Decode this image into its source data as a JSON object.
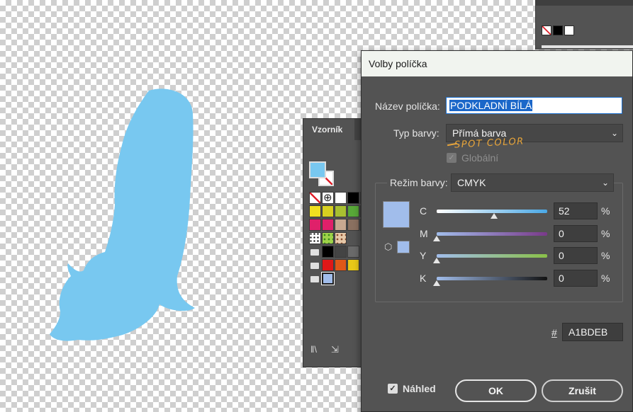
{
  "app_colors": {
    "accent": "#1b67c9",
    "swatch_color": "#A1BDEB",
    "artwork_fill": "#78C8F0",
    "annotation": "#E8A53A"
  },
  "swatches_panel": {
    "tab_label": "Vzorník",
    "icons": [
      "library-icon",
      "import-swatches-icon"
    ],
    "rows": [
      [
        "none",
        "registration",
        "#ffffff",
        "#000000",
        "#2a8a3a"
      ],
      [
        "#f0e020",
        "#d8d020",
        "#a8c030",
        "#58a838",
        "#2a9a48"
      ],
      [
        "#e0206a",
        "#e0206a",
        "#c8a890",
        "#8a7060",
        "#5a4a40"
      ],
      [
        "pattern1",
        "pattern2",
        "pattern3"
      ],
      [
        "folder",
        "#000000",
        "#444444",
        "#6a6a6a"
      ],
      [
        "folder",
        "#e01818",
        "#e05818",
        "#e8c818"
      ],
      [
        "folder",
        "selected"
      ]
    ]
  },
  "dialog": {
    "title": "Volby políčka",
    "name_label": "Název políčka:",
    "name_value": "PODKLADNÍ BÍLÁ",
    "color_type_label": "Typ barvy:",
    "color_type_value": "Přímá barva",
    "annotation": "SPOT COLOR",
    "global_label": "Globální",
    "global_checked": true,
    "mode_label": "Režim barvy:",
    "mode_value": "CMYK",
    "channels": [
      {
        "name": "C",
        "value": "52",
        "unit": "%",
        "level": 0.52
      },
      {
        "name": "M",
        "value": "0",
        "unit": "%",
        "level": 0
      },
      {
        "name": "Y",
        "value": "0",
        "unit": "%",
        "level": 0
      },
      {
        "name": "K",
        "value": "0",
        "unit": "%",
        "level": 0
      }
    ],
    "hex_symbol": "#",
    "hex_value": "A1BDEB",
    "preview_label": "Náhled",
    "preview_checked": true,
    "ok_label": "OK",
    "cancel_label": "Zrušit"
  }
}
